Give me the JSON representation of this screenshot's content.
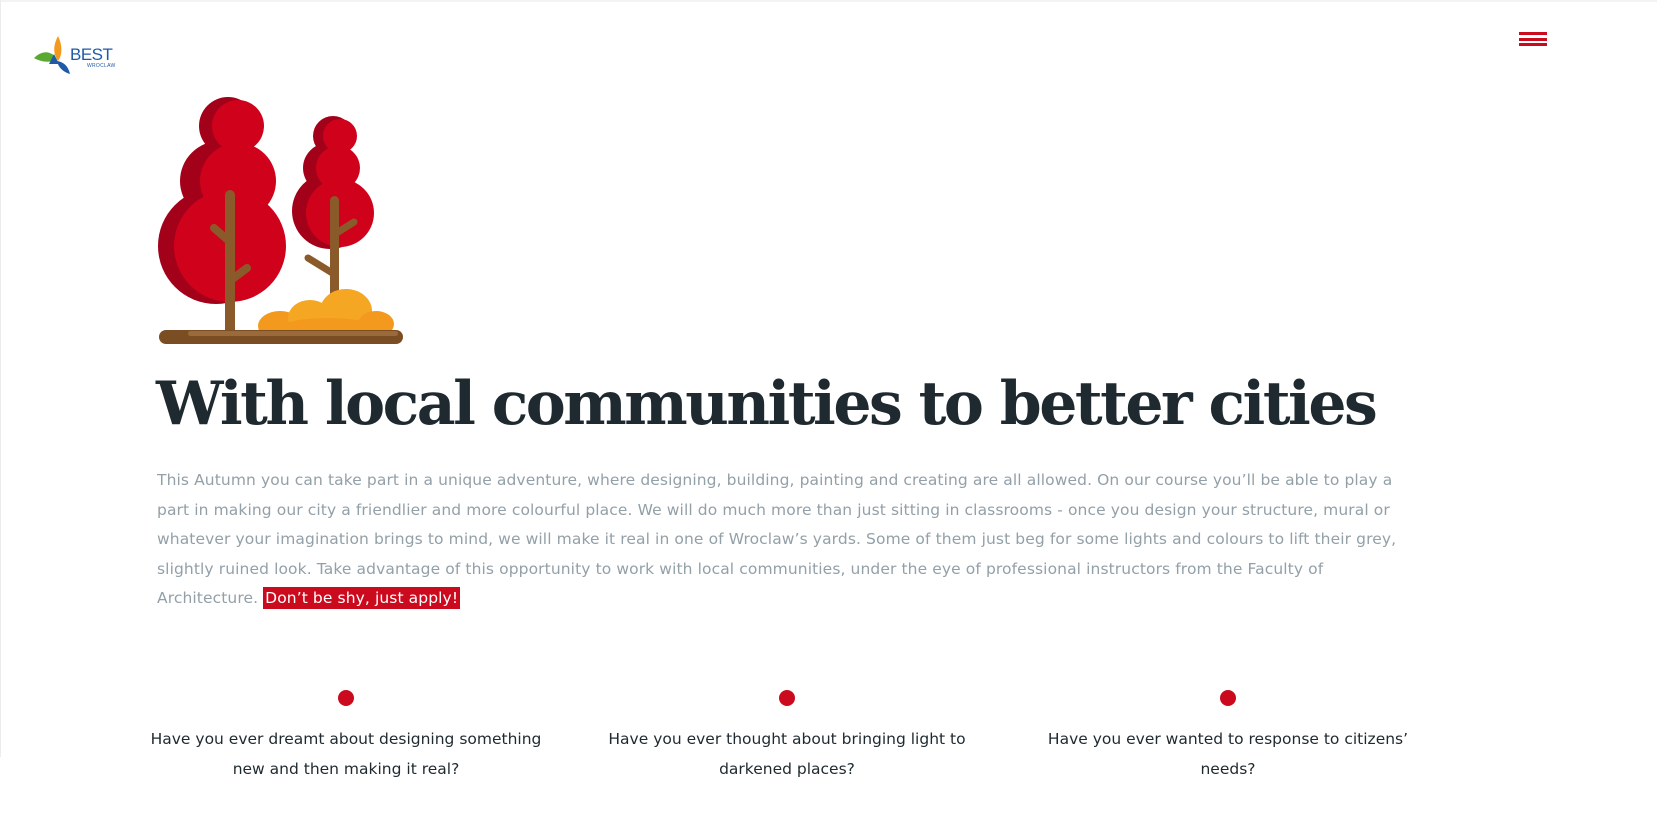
{
  "header": {
    "logo": {
      "name": "BEST",
      "subtitle": "WROCLAW",
      "icon": "best-logo-icon",
      "colors": {
        "blue": "#1f5aa6",
        "orange": "#f39a1e",
        "green": "#5aa832"
      }
    },
    "menu": {
      "icon": "hamburger-icon",
      "color": "#cc0a1e"
    }
  },
  "hero": {
    "illustration": "autumn-trees-illustration",
    "title": "With local communities to better cities",
    "intro_text": "This Autumn you can take part in a unique adventure, where designing, building, painting and creating are all allowed. On our course you’ll be able to play a part in making our city a friendlier and more colourful place. We will do much more than just sitting in classrooms - once you design your structure, mural or whatever your imagination brings to mind, we will make it real in one of Wroclaw’s yards. Some of them just beg for some lights and colours to lift their grey, slightly ruined look. Take advantage of this opportunity to work with local communities, under the eye of professional instructors from the Faculty of Architecture.",
    "cta_text": "Don’t be shy, just apply!"
  },
  "questions": [
    {
      "text": "Have you ever dreamt about designing something new and then making it real?"
    },
    {
      "text": "Have you ever thought about bringing light to darkened places?"
    },
    {
      "text": "Have you ever wanted to response to citizens’ needs?"
    }
  ],
  "colors": {
    "accent": "#cc0a1e",
    "heading": "#1f2a30",
    "body_text": "#93a0a8",
    "tree_red": "#d0021b",
    "tree_dark_red": "#a3001a",
    "trunk": "#8a5a2b",
    "bush": "#f5a623"
  }
}
